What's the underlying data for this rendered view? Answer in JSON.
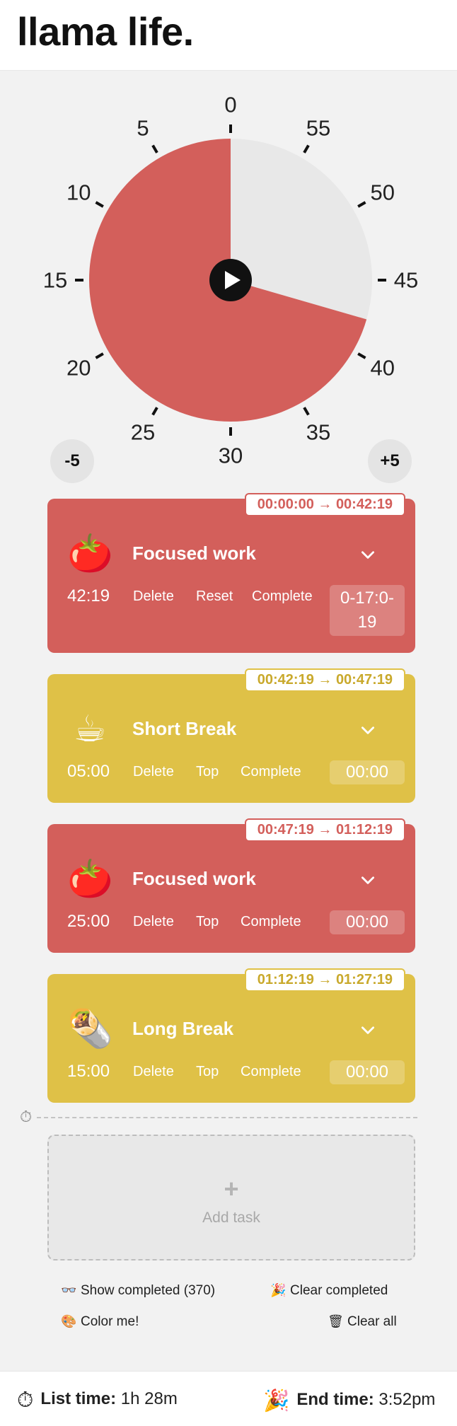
{
  "brand": "llama life.",
  "timer": {
    "tick_labels": [
      "0",
      "55",
      "50",
      "45",
      "40",
      "35",
      "30",
      "25",
      "20",
      "15",
      "10",
      "5"
    ],
    "remaining_minutes": 42.3167,
    "dial_minutes": 60,
    "colors": {
      "remaining": "#d35f5b",
      "empty": "#e8e8e8"
    },
    "play_icon": "play-icon",
    "minus_label": "-5",
    "plus_label": "+5"
  },
  "tasks": [
    {
      "emoji": "🍅",
      "name": "Focused work",
      "duration": "42:19",
      "actions": [
        "Delete",
        "Reset",
        "Complete"
      ],
      "count_line1": "0-17:0-",
      "count_line2": "19",
      "range": "00:00:00 → 00:42:19",
      "color": "#d35f5b"
    },
    {
      "emoji": "☕",
      "name": "Short Break",
      "duration": "05:00",
      "actions": [
        "Delete",
        "Top",
        "Complete"
      ],
      "count": "00:00",
      "range": "00:42:19 → 00:47:19",
      "color": "#dfc147"
    },
    {
      "emoji": "🍅",
      "name": "Focused work",
      "duration": "25:00",
      "actions": [
        "Delete",
        "Top",
        "Complete"
      ],
      "count": "00:00",
      "range": "00:47:19 → 01:12:19",
      "color": "#d35f5b"
    },
    {
      "emoji": "🌯",
      "name": "Long Break",
      "duration": "15:00",
      "actions": [
        "Delete",
        "Top",
        "Complete"
      ],
      "count": "00:00",
      "range": "01:12:19 → 01:27:19",
      "color": "#dfc147"
    }
  ],
  "divider_icon": "stopwatch-icon",
  "add_task": {
    "plus": "+",
    "label": "Add task"
  },
  "options": {
    "show_completed": "Show completed (370)",
    "clear_completed": "Clear completed",
    "color_me": "Color me!",
    "clear_all": "Clear all"
  },
  "footer": {
    "list_time_label": "List time:",
    "list_time_value": "1h 28m",
    "end_time_label": "End time:",
    "end_time_value": "3:52pm"
  }
}
